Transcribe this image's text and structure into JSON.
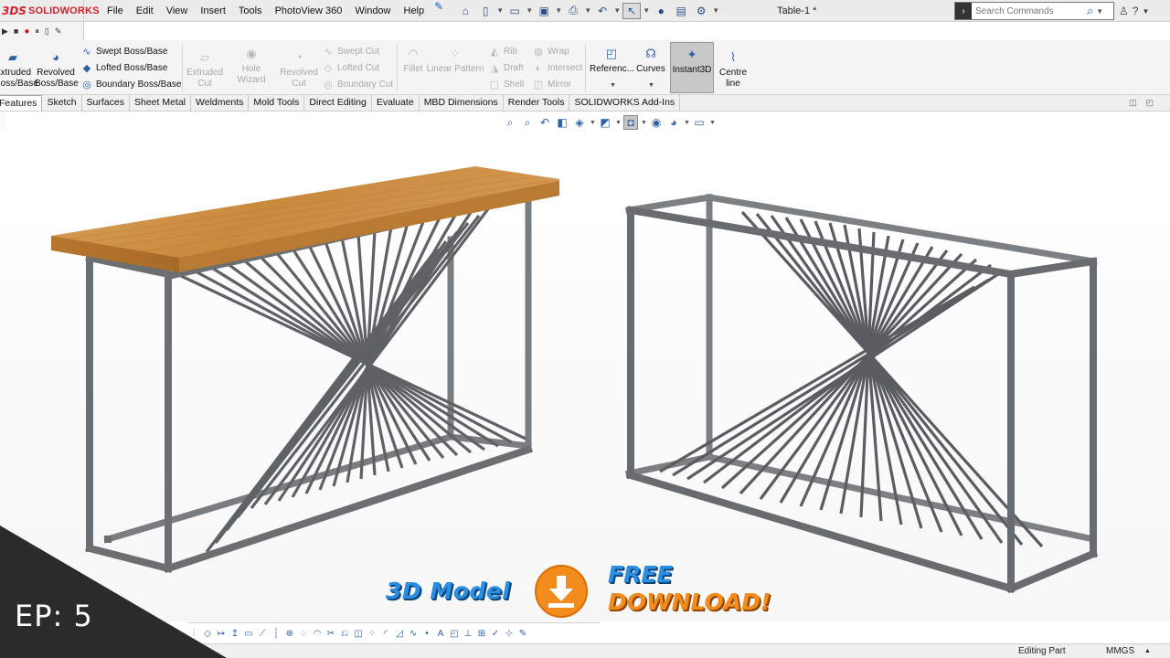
{
  "app": {
    "brand_ds": "3DS",
    "brand_name": "SOLIDWORKS",
    "document_title": "Table-1 *"
  },
  "menu": [
    "File",
    "Edit",
    "View",
    "Insert",
    "Tools",
    "PhotoView 360",
    "Window",
    "Help"
  ],
  "search": {
    "placeholder": "Search Commands"
  },
  "ribbon": {
    "extruded_boss": "Extruded Boss/Base",
    "revolved_boss": "Revolved Boss/Base",
    "swept_boss": "Swept Boss/Base",
    "lofted_boss": "Lofted Boss/Base",
    "boundary_boss": "Boundary Boss/Base",
    "extruded_cut": "Extruded Cut",
    "hole_wizard": "Hole Wizard",
    "revolved_cut": "Revolved Cut",
    "swept_cut": "Swept Cut",
    "lofted_cut": "Lofted Cut",
    "boundary_cut": "Boundary Cut",
    "fillet": "Fillet",
    "linear_pattern": "Linear Pattern",
    "rib": "Rib",
    "draft": "Draft",
    "shell": "Shell",
    "wrap": "Wrap",
    "intersect": "Intersect",
    "mirror": "Mirror",
    "reference": "Referenc...",
    "curves": "Curves",
    "instant3d": "Instant3D",
    "centre_line": "Centre line"
  },
  "tabs": [
    "Features",
    "Sketch",
    "Surfaces",
    "Sheet Metal",
    "Weldments",
    "Mold Tools",
    "Direct Editing",
    "Evaluate",
    "MBD Dimensions",
    "Render Tools",
    "SOLIDWORKS Add-Ins"
  ],
  "banner": {
    "model_text": "3D Model",
    "free_text": "FREE",
    "download_text": "DOWNLOAD!"
  },
  "episode": "EP: 5",
  "status": {
    "mode": "Editing Part",
    "units": "MMGS"
  },
  "colors": {
    "wood": "#c98a3e",
    "steel": "#6f7275",
    "accent_blue": "#2b8ee0",
    "accent_orange": "#f28c1d"
  }
}
